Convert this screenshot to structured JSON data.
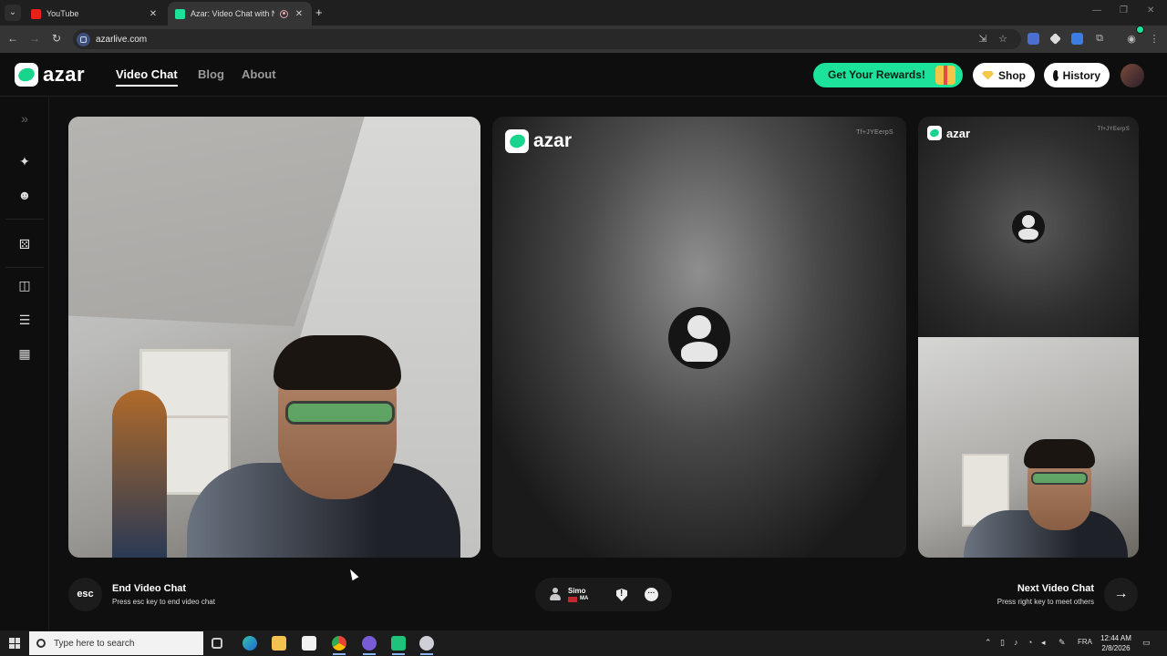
{
  "browser": {
    "tabs": [
      {
        "title": "YouTube",
        "favicon_color": "#e62117"
      },
      {
        "title": "Azar: Video Chat with New",
        "favicon_color": "#1de39a"
      }
    ],
    "url": "azarlive.com"
  },
  "header": {
    "logo_text": "azar",
    "nav": [
      "Video Chat",
      "Blog",
      "About"
    ],
    "rewards_label": "Get Your Rewards!",
    "shop_label": "Shop",
    "history_label": "History"
  },
  "panels": {
    "logo_text": "azar",
    "remote_id": "Tf+JYEerpS",
    "remote2_id": "Tf+JYEerpS"
  },
  "controls": {
    "esc_label": "esc",
    "end_title": "End Video Chat",
    "end_sub": "Press esc key to end video chat",
    "peer_name": "Simo",
    "peer_country": "MA",
    "next_title": "Next Video Chat",
    "next_sub": "Press right key to meet others",
    "next_arrow": "→"
  },
  "taskbar": {
    "search_placeholder": "Type here to search",
    "language": "FRA",
    "time": "12:44 AM",
    "date": "2/8/2026"
  },
  "colors": {
    "accent": "#1de39a",
    "background": "#0e0e0f"
  },
  "icons": [
    "expand-icon",
    "magic-wand-icon",
    "face-icon",
    "dice-icon",
    "layout-split-icon",
    "layout-stack-icon",
    "layout-grid-icon"
  ]
}
